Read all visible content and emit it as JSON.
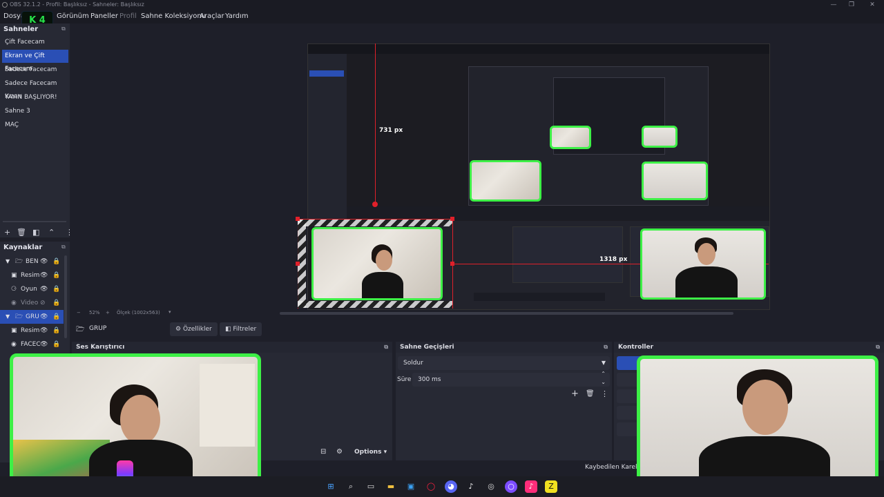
{
  "titlebar": {
    "title": "OBS 32.1.2 - Profil: Başlıksız - Sahneler: Başlıksız"
  },
  "menu": {
    "items": [
      "Dosya",
      "Görünüm",
      "Paneller",
      "Profil",
      "Sahne Koleksiyonu",
      "Araçlar",
      "Yardım"
    ]
  },
  "logo": {
    "text": "K 4",
    "color": "#27e24a"
  },
  "scenes": {
    "header": "Sahneler",
    "items": [
      {
        "label": "Çift Facecam",
        "selected": false
      },
      {
        "label": "Ekran ve Çift Facecam",
        "selected": true
      },
      {
        "label": "Sadece Facecam",
        "selected": false
      },
      {
        "label": "Sadece Facecam Kızan",
        "selected": false
      },
      {
        "label": "YAYIN BAŞLIYOR!",
        "selected": false
      },
      {
        "label": "Sahne 3",
        "selected": false
      },
      {
        "label": "MAÇ",
        "selected": false
      }
    ]
  },
  "sources": {
    "header": "Kaynaklar",
    "items": [
      {
        "label": "BEN",
        "group": true,
        "indent": false,
        "selected": false
      },
      {
        "label": "Resim",
        "group": false,
        "indent": true,
        "selected": false
      },
      {
        "label": "Oyun",
        "group": false,
        "indent": true,
        "selected": false
      },
      {
        "label": "Video",
        "group": false,
        "indent": true,
        "selected": false
      },
      {
        "label": "GRU",
        "group": true,
        "indent": false,
        "selected": true
      },
      {
        "label": "Resim",
        "group": false,
        "indent": true,
        "selected": false
      },
      {
        "label": "FACEC",
        "group": false,
        "indent": true,
        "selected": false
      }
    ]
  },
  "preview": {
    "measure_vertical": "731 px",
    "measure_horizontal": "1318 px",
    "zoom": "52%",
    "scale_label": "Ölçek (1002x563)"
  },
  "context": {
    "source_name": "GRUP",
    "properties_label": "Özellikler",
    "filters_label": "Filtreler"
  },
  "mixer": {
    "header": "Ses Karıştırıcı",
    "options_label": "Options"
  },
  "transitions": {
    "header": "Sahne Geçişleri",
    "selected": "Soldur",
    "duration_label": "Süre",
    "duration_value": "300 ms"
  },
  "controls": {
    "header": "Kontroller"
  },
  "status": {
    "dropped_frames": "Kaybedilen Kareler"
  },
  "colors": {
    "accent": "#2a4fb5",
    "cam_border": "#3df046",
    "guide": "#e0202a"
  }
}
